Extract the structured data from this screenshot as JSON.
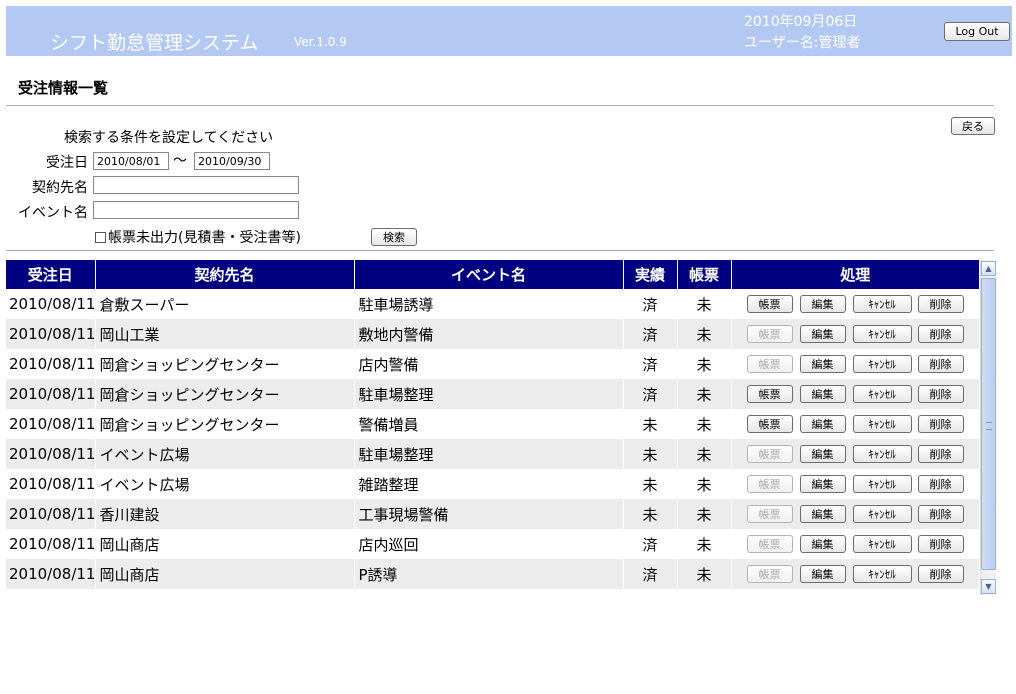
{
  "header": {
    "app_title": "シフト勤怠管理システム",
    "version": "Ver.1.0.9",
    "date": "2010年09月06日",
    "user": "ユーザー名:管理者",
    "logout_label": "Log Out",
    "bg_color": "#b4c8f4"
  },
  "page": {
    "title": "受注情報一覧",
    "back_label": "戻る"
  },
  "search": {
    "caption": "検索する条件を設定してください",
    "order_date_label": "受注日",
    "date_from": "2010/08/01",
    "tilde": "〜",
    "date_to": "2010/09/30",
    "customer_label": "契約先名",
    "customer_value": "",
    "event_label": "イベント名",
    "event_value": "",
    "unprinted_label": "帳票未出力(見積書・受注書等)",
    "search_label": "検索"
  },
  "table": {
    "header_color": "#000080",
    "columns": [
      "受注日",
      "契約先名",
      "イベント名",
      "実績",
      "帳票",
      "処理"
    ],
    "action_labels": {
      "doc": "帳票",
      "edit": "編集",
      "cancel": "ｷｬﾝｾﾙ",
      "delete": "削除"
    },
    "rows": [
      {
        "date": "2010/08/11",
        "customer": "倉敷スーパー",
        "event": "駐車場誘導",
        "result": "済",
        "doc": "未",
        "doc_enabled": true
      },
      {
        "date": "2010/08/11",
        "customer": "岡山工業",
        "event": "敷地内警備",
        "result": "済",
        "doc": "未",
        "doc_enabled": false
      },
      {
        "date": "2010/08/11",
        "customer": "岡倉ショッピングセンター",
        "event": "店内警備",
        "result": "済",
        "doc": "未",
        "doc_enabled": false
      },
      {
        "date": "2010/08/11",
        "customer": "岡倉ショッピングセンター",
        "event": "駐車場整理",
        "result": "済",
        "doc": "未",
        "doc_enabled": true
      },
      {
        "date": "2010/08/11",
        "customer": "岡倉ショッピングセンター",
        "event": "警備増員",
        "result": "未",
        "doc": "未",
        "doc_enabled": true
      },
      {
        "date": "2010/08/11",
        "customer": "イベント広場",
        "event": "駐車場整理",
        "result": "未",
        "doc": "未",
        "doc_enabled": false
      },
      {
        "date": "2010/08/11",
        "customer": "イベント広場",
        "event": "雑踏整理",
        "result": "未",
        "doc": "未",
        "doc_enabled": false
      },
      {
        "date": "2010/08/11",
        "customer": "香川建設",
        "event": "工事現場警備",
        "result": "未",
        "doc": "未",
        "doc_enabled": false
      },
      {
        "date": "2010/08/11",
        "customer": "岡山商店",
        "event": "店内巡回",
        "result": "済",
        "doc": "未",
        "doc_enabled": false
      },
      {
        "date": "2010/08/11",
        "customer": "岡山商店",
        "event": "P誘導",
        "result": "済",
        "doc": "未",
        "doc_enabled": false
      }
    ]
  }
}
